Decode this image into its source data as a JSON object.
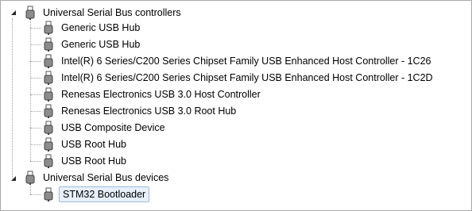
{
  "tree": {
    "categories": [
      {
        "label": "Universal Serial Bus controllers",
        "expanded": true,
        "children": [
          "Generic USB Hub",
          "Generic USB Hub",
          "Intel(R) 6 Series/C200 Series Chipset Family USB Enhanced Host Controller - 1C26",
          "Intel(R) 6 Series/C200 Series Chipset Family USB Enhanced Host Controller - 1C2D",
          "Renesas Electronics USB 3.0 Host Controller",
          "Renesas Electronics USB 3.0 Root Hub",
          "USB Composite Device",
          "USB Root Hub",
          "USB Root Hub"
        ]
      },
      {
        "label": "Universal Serial Bus devices",
        "expanded": true,
        "children": [
          "STM32 Bootloader"
        ],
        "selected_child": "STM32 Bootloader"
      }
    ]
  },
  "icons": {
    "category": "usb-connector-icon",
    "device": "usb-connector-icon",
    "expander": "expanded-triangle-icon"
  },
  "colors": {
    "selection_fill": "#e7f0fb",
    "selection_border": "#9cbbe0",
    "tree_lines": "#a0a0a0"
  }
}
